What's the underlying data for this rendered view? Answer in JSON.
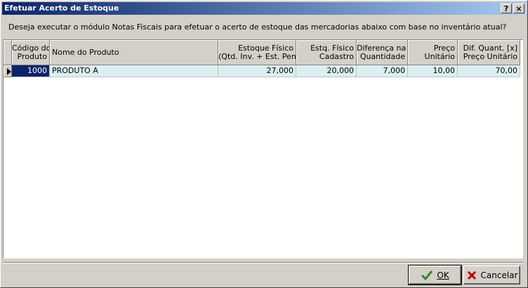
{
  "window": {
    "title": "Efetuar Acerto de Estoque",
    "help_label": "?",
    "close_label": "×"
  },
  "message": "Deseja executar o módulo Notas Fiscais para efetuar o acerto de estoque das mercadorias abaixo com base no inventário atual?",
  "grid": {
    "columns": [
      {
        "line1": "Código do",
        "line2": "Produto"
      },
      {
        "line1": "Nome do Produto",
        "line2": ""
      },
      {
        "line1": "Estoque Físico",
        "line2": "(Qtd. Inv. + Est. Pend)"
      },
      {
        "line1": "Estq. Físico",
        "line2": "Cadastro"
      },
      {
        "line1": "Diferença na",
        "line2": "Quantidade"
      },
      {
        "line1": "Preço",
        "line2": "Unitário"
      },
      {
        "line1": "Dif. Quant. [x]",
        "line2": "Preço Unitário"
      }
    ],
    "rows": [
      [
        "1000",
        "PRODUTO A",
        "27,000",
        "20,000",
        "7,000",
        "10,00",
        "70,00"
      ]
    ]
  },
  "buttons": {
    "ok_label": "OK",
    "cancel_label": "Cancelar"
  },
  "colors": {
    "title_start": "#0a246a",
    "title_end": "#a6caf0",
    "row_background": "#dbeff2",
    "selected_cell": "#0a246a",
    "ok_check": "#2e8b2e",
    "cancel_x": "#c00000"
  }
}
